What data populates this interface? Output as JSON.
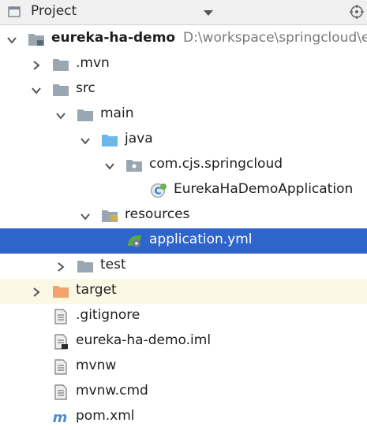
{
  "panel": {
    "title": "Project",
    "title_icon": "project-window-icon",
    "locate_icon": "crosshair-icon"
  },
  "tree": [
    {
      "label": "eureka-ha-demo",
      "path": "D:\\workspace\\springcloud\\e",
      "icon": "module-folder",
      "arrow": "down",
      "bold": true
    },
    {
      "label": ".mvn",
      "icon": "folder",
      "arrow": "right"
    },
    {
      "label": "src",
      "icon": "folder",
      "arrow": "down"
    },
    {
      "label": "main",
      "icon": "folder",
      "arrow": "down"
    },
    {
      "label": "java",
      "icon": "source-folder",
      "arrow": "down"
    },
    {
      "label": "com.cjs.springcloud",
      "icon": "package",
      "arrow": "down"
    },
    {
      "label": "EurekaHaDemoApplication",
      "icon": "spring-boot-class",
      "arrow": "none"
    },
    {
      "label": "resources",
      "icon": "resources-folder",
      "arrow": "down"
    },
    {
      "label": "application.yml",
      "icon": "spring-yml",
      "arrow": "none",
      "selected": true
    },
    {
      "label": "test",
      "icon": "folder",
      "arrow": "right"
    },
    {
      "label": "target",
      "icon": "excluded-folder",
      "arrow": "right",
      "highlight": true
    },
    {
      "label": ".gitignore",
      "icon": "text-file",
      "arrow": "none"
    },
    {
      "label": "eureka-ha-demo.iml",
      "icon": "iml-file",
      "arrow": "none"
    },
    {
      "label": "mvnw",
      "icon": "text-file",
      "arrow": "none"
    },
    {
      "label": "mvnw.cmd",
      "icon": "text-file",
      "arrow": "none"
    },
    {
      "label": "pom.xml",
      "icon": "maven-file",
      "arrow": "none"
    }
  ],
  "colors": {
    "selection": "#2f65ca",
    "highlight": "#fbf8e5",
    "folder": "#9aa7b0",
    "source_folder": "#6cb8e6",
    "excluded_folder": "#f2a36b"
  }
}
